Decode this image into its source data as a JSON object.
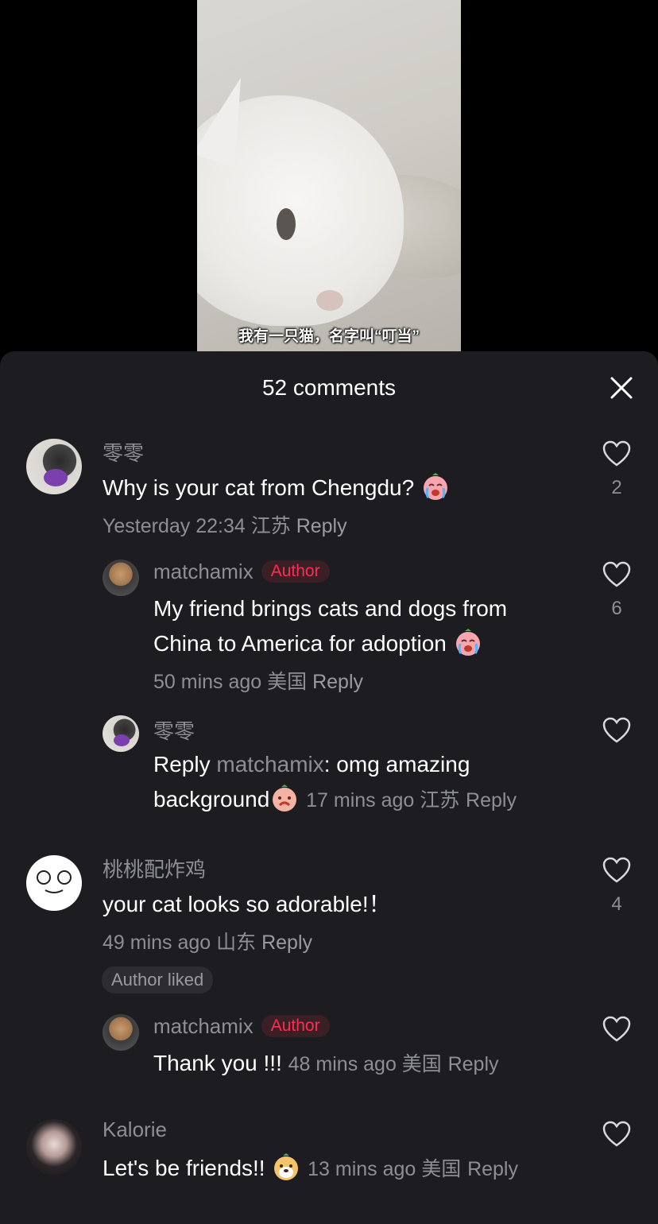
{
  "video": {
    "subtitle": "我有一只猫，名字叫“叮当”"
  },
  "sheet": {
    "title": "52 comments",
    "reply_label": "Reply",
    "author_badge": "Author",
    "author_liked_label": "Author liked"
  },
  "comments": [
    {
      "user": "零零",
      "text": "Why is your cat from Chengdu?",
      "meta": "Yesterday 22:34 江苏",
      "likes": "2",
      "replies": [
        {
          "user": "matchamix",
          "text_line1": "My friend brings cats and dogs from",
          "text_line2": "China to America for adoption",
          "meta": "50 mins ago 美国",
          "likes": "6"
        },
        {
          "user": "零零",
          "reply_prefix": "Reply",
          "reply_to": "matchamix",
          "text_line1": ": omg amazing",
          "text_line2": "background",
          "meta": "17 mins ago 江苏"
        }
      ]
    },
    {
      "user": "桃桃配炸鸡",
      "text": "your cat looks so adorable!！",
      "meta": "49 mins ago 山东",
      "likes": "4",
      "replies": [
        {
          "user": "matchamix",
          "text": "Thank you !!!",
          "meta": "48 mins ago 美国"
        }
      ]
    },
    {
      "user": "Kalorie",
      "text": "Let's be friends!!",
      "meta": "13 mins ago 美国"
    }
  ],
  "icons": {
    "close": "close-icon",
    "like": "heart-outline-icon",
    "emoji_cry": "crying-face-emoji",
    "emoji_shy": "shy-face-emoji",
    "emoji_dog": "dog-face-emoji"
  },
  "colors": {
    "sheet_bg": "#1c1c21",
    "author_badge": "#fe2c55",
    "muted_text": "#8e8e95"
  }
}
